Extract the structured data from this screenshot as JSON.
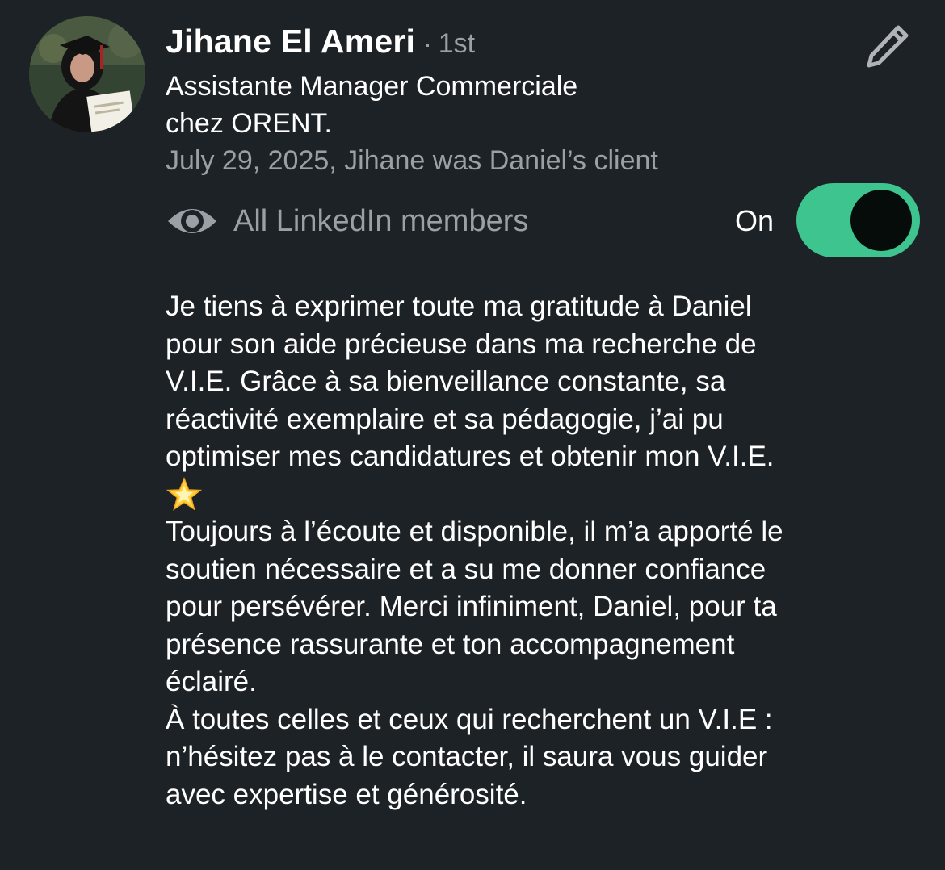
{
  "author": {
    "name": "Jihane El Ameri",
    "degree_separator": "·",
    "degree": "1st",
    "headline": "Assistante Manager Commerciale\nchez ORENT.",
    "meta": "July 29, 2025, Jihane was Daniel’s client"
  },
  "visibility": {
    "icon": "eye-icon",
    "label": "All LinkedIn members",
    "toggle_label": "On",
    "toggle_on": true
  },
  "edit": {
    "icon": "pencil-icon"
  },
  "recommendation": {
    "paragraph1": "Je tiens à exprimer toute ma gratitude à Daniel\npour son aide précieuse dans ma recherche de\nV.I.E. Grâce à sa bienveillance constante, sa\nréactivité exemplaire et sa pédagogie, j’ai pu\noptimiser mes candidatures et obtenir mon V.I.E.",
    "emoji": "🌟",
    "paragraph2": "Toujours à l’écoute et disponible, il m’a apporté le\nsoutien nécessaire et a su me donner confiance\npour persévérer. Merci infiniment, Daniel, pour ta\nprésence rassurante et ton accompagnement\néclairé.\nÀ toutes celles et ceux qui recherchent un V.I.E :\nn’hésitez pas à le contacter, il saura vous guider\navec expertise et générosité."
  },
  "colors": {
    "background": "#1d2226",
    "toggle_on": "#3ec48f",
    "muted_text": "#9aa0a6"
  }
}
